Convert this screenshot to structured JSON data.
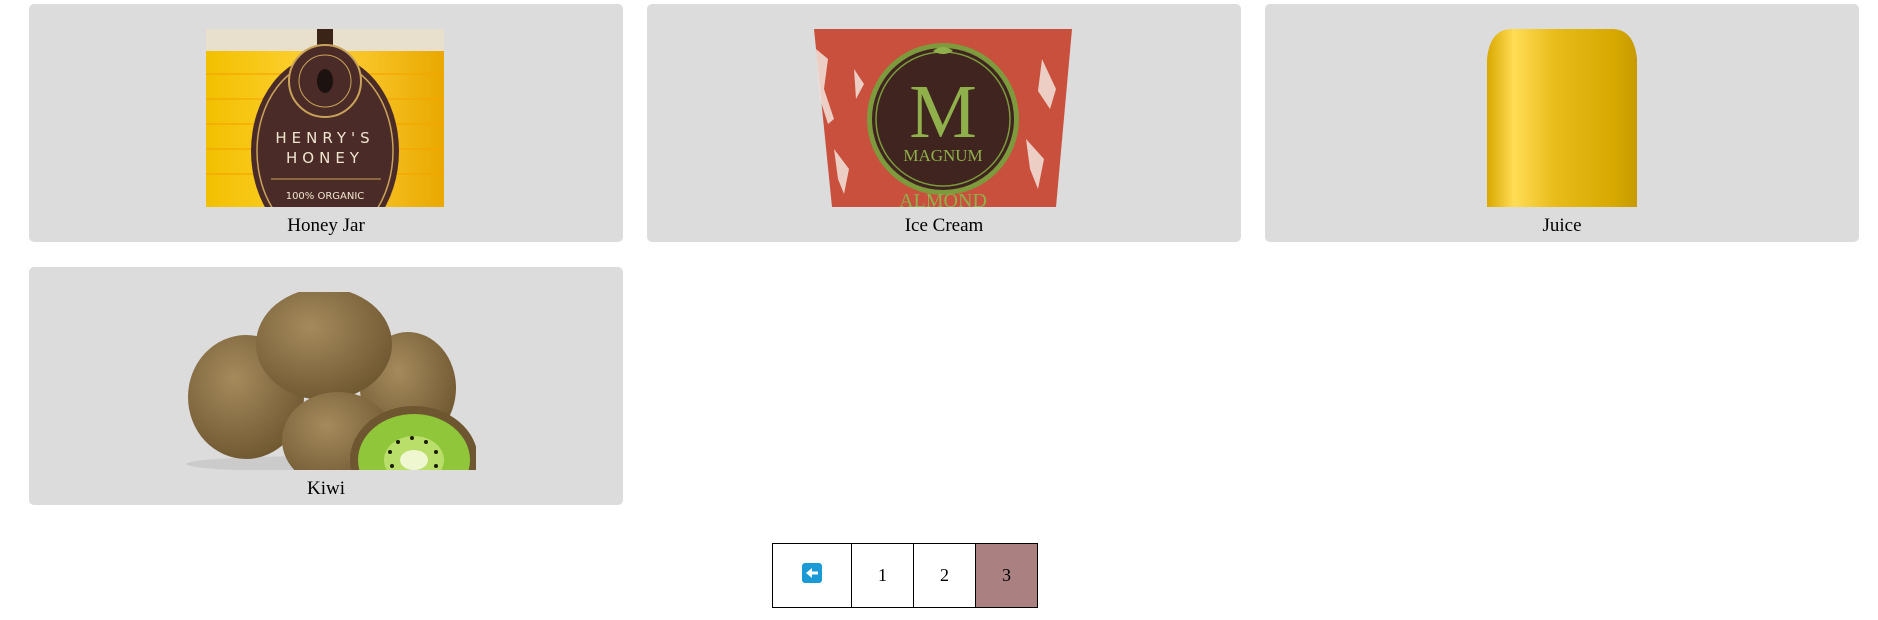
{
  "products": [
    {
      "name": "Honey Jar",
      "icon": "honey-jar-image"
    },
    {
      "name": "Ice Cream",
      "icon": "ice-cream-tub-image"
    },
    {
      "name": "Juice",
      "icon": "juice-bottle-image"
    },
    {
      "name": "Kiwi",
      "icon": "kiwi-fruit-image"
    }
  ],
  "honey_label": {
    "line1": "HENRY'S",
    "line2": "HONEY",
    "line3": "100% ORGANIC"
  },
  "icecream_label": {
    "letter": "M",
    "brand": "MAGNUM",
    "flavor": "ALMOND"
  },
  "pagination": {
    "prev_icon": "arrow-left-icon",
    "pages": [
      "1",
      "2",
      "3"
    ],
    "current_page": "3"
  },
  "colors": {
    "card_bg": "#dcdcdc",
    "active_page": "#ab8080",
    "prev_icon": "#1a9ad6"
  }
}
